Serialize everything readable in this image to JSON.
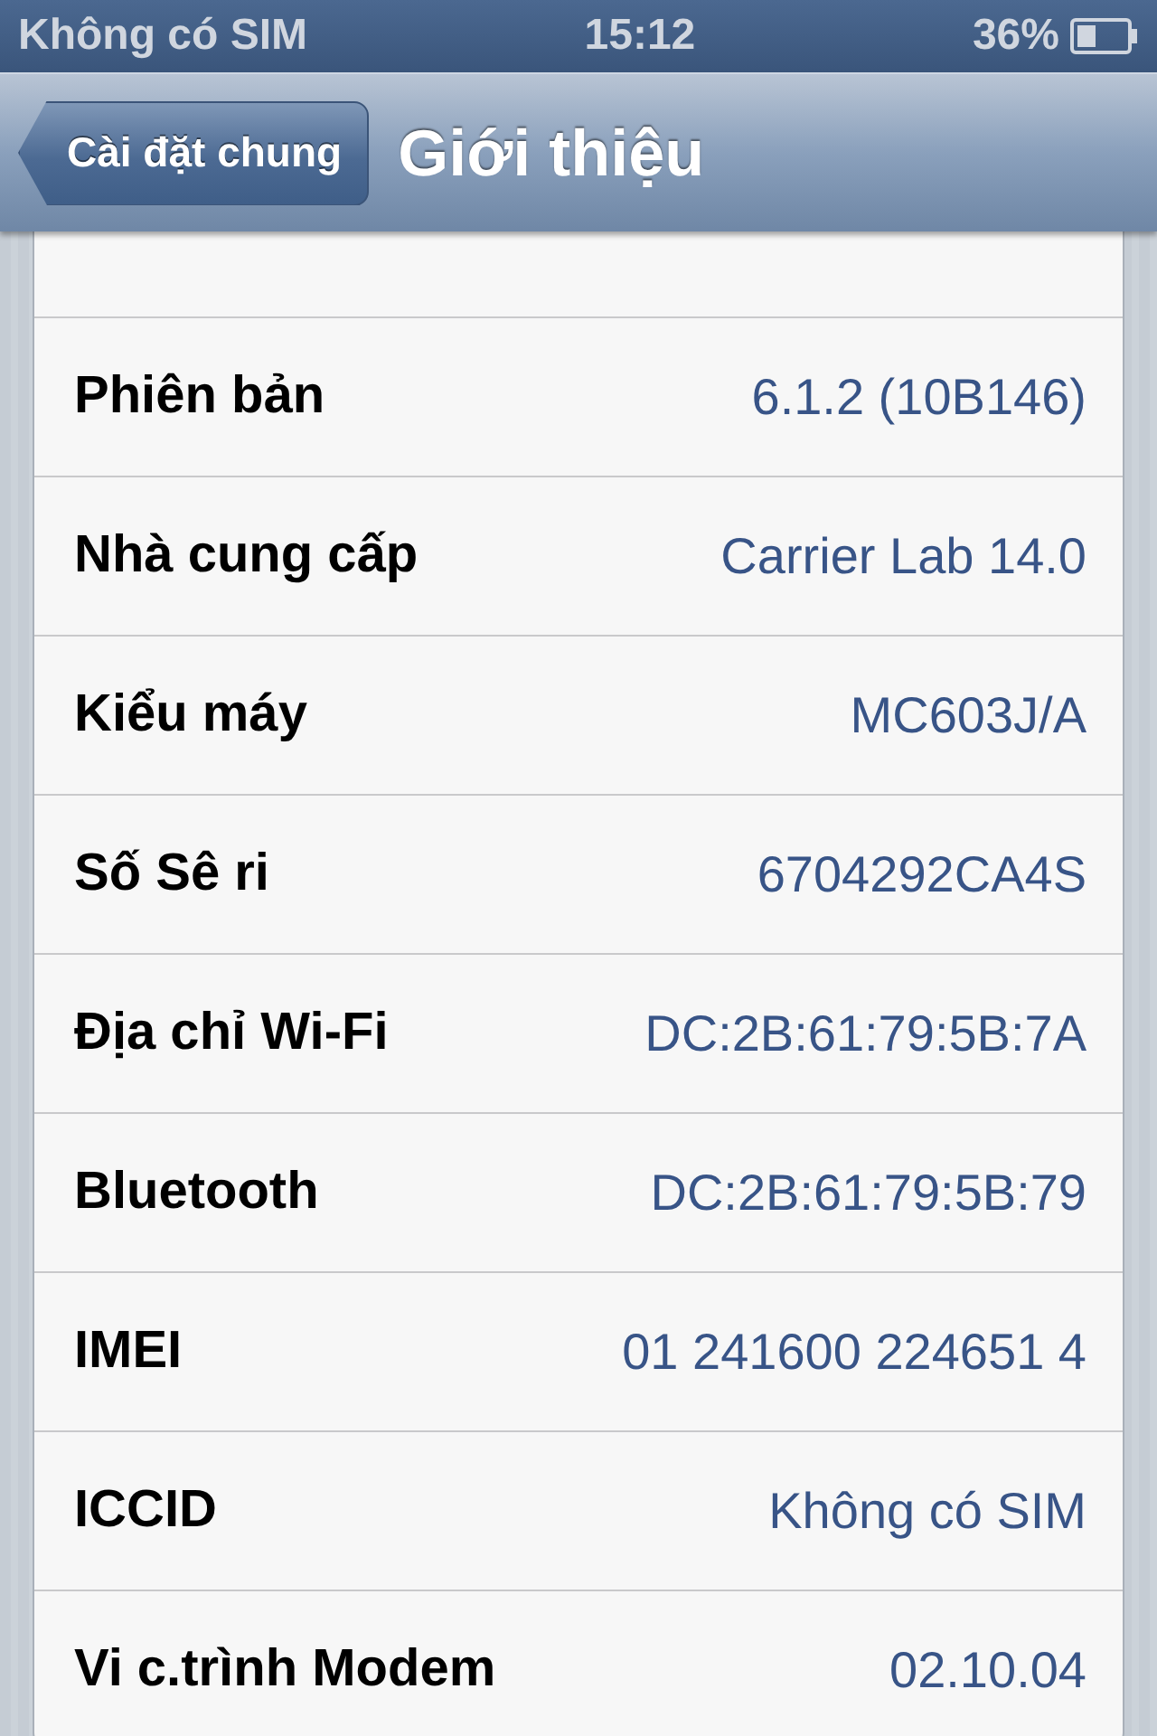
{
  "status_bar": {
    "carrier": "Không có SIM",
    "time": "15:12",
    "battery": "36%"
  },
  "nav_bar": {
    "back_button": "Cài đặt chung",
    "title": "Giới thiệu"
  },
  "rows": [
    {
      "label": "Phiên bản",
      "value": "6.1.2 (10B146)"
    },
    {
      "label": "Nhà cung cấp",
      "value": "Carrier Lab 14.0"
    },
    {
      "label": "Kiểu máy",
      "value": "MC603J/A"
    },
    {
      "label": "Số Sê ri",
      "value": "6704292CA4S"
    },
    {
      "label": "Địa chỉ Wi-Fi",
      "value": "DC:2B:61:79:5B:7A"
    },
    {
      "label": "Bluetooth",
      "value": "DC:2B:61:79:5B:79"
    },
    {
      "label": "IMEI",
      "value": "01 241600 224651 4"
    },
    {
      "label": "ICCID",
      "value": "Không có SIM"
    },
    {
      "label": "Vi c.trình Modem",
      "value": "02.10.04"
    }
  ]
}
